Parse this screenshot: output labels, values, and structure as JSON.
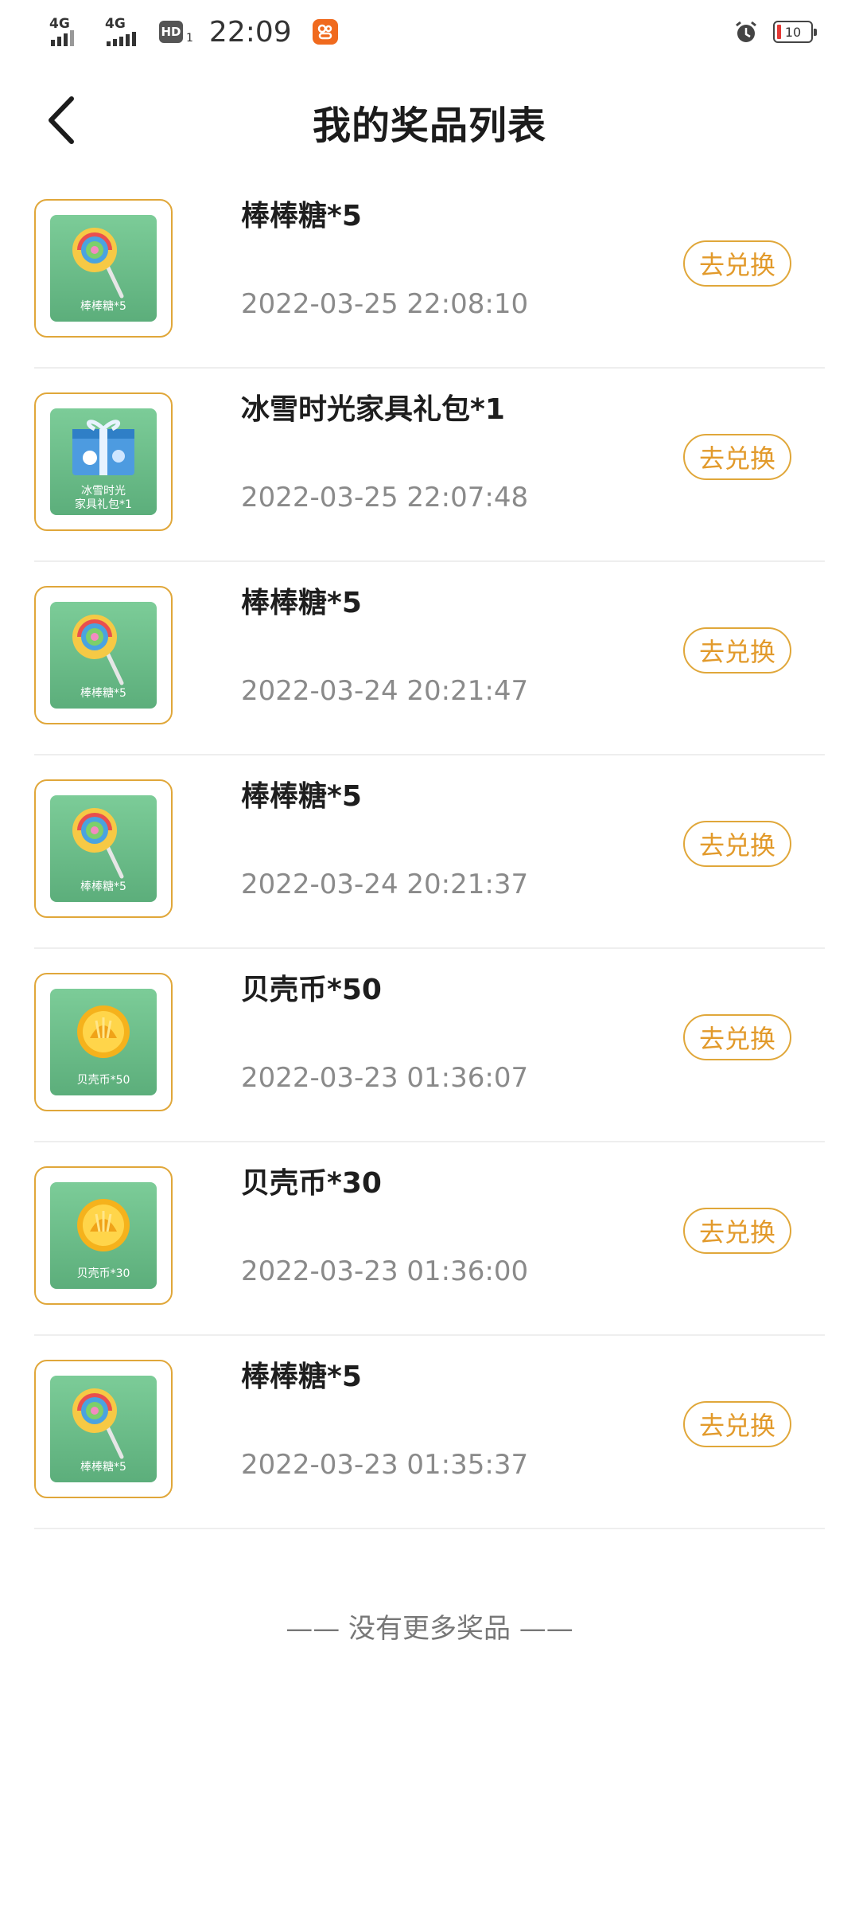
{
  "status_bar": {
    "net1": "4G",
    "net2": "4G",
    "hd": "HD",
    "hd_sub": "1",
    "time": "22:09",
    "battery": "10",
    "colors": {
      "battery_low": "#e53935",
      "app_badge": "#f06a1e"
    }
  },
  "header": {
    "title": "我的奖品列表"
  },
  "prizes": [
    {
      "name": "棒棒糖*5",
      "time": "2022-03-25 22:08:10",
      "thumb_label": "棒棒糖*5",
      "icon": "lollipop-icon",
      "button": "去兑换"
    },
    {
      "name": "冰雪时光家具礼包*1",
      "time": "2022-03-25 22:07:48",
      "thumb_label_1": "冰雪时光",
      "thumb_label_2": "家具礼包*1",
      "icon": "gift-box-icon",
      "button": "去兑换"
    },
    {
      "name": "棒棒糖*5",
      "time": "2022-03-24 20:21:47",
      "thumb_label": "棒棒糖*5",
      "icon": "lollipop-icon",
      "button": "去兑换"
    },
    {
      "name": "棒棒糖*5",
      "time": "2022-03-24 20:21:37",
      "thumb_label": "棒棒糖*5",
      "icon": "lollipop-icon",
      "button": "去兑换"
    },
    {
      "name": "贝壳币*50",
      "time": "2022-03-23 01:36:07",
      "thumb_label": "贝壳币*50",
      "icon": "shell-coin-icon",
      "button": "去兑换"
    },
    {
      "name": "贝壳币*30",
      "time": "2022-03-23 01:36:00",
      "thumb_label": "贝壳币*30",
      "icon": "shell-coin-icon",
      "button": "去兑换"
    },
    {
      "name": "棒棒糖*5",
      "time": "2022-03-23 01:35:37",
      "thumb_label": "棒棒糖*5",
      "icon": "lollipop-icon",
      "button": "去兑换"
    }
  ],
  "footer": {
    "text": "—— 没有更多奖品 ——"
  },
  "colors": {
    "accent": "#e0a73a",
    "thumb_bg": "#6bbf8a"
  }
}
